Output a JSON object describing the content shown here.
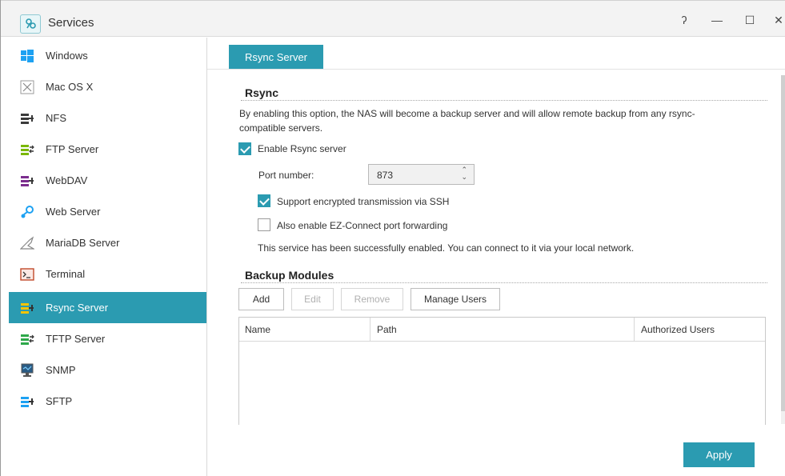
{
  "window": {
    "title": "Services",
    "help_glyph": "ʔ",
    "minimize_glyph": "—",
    "maximize_glyph": "☐",
    "close_glyph": "✕"
  },
  "sidebar": {
    "items": [
      {
        "label": "Windows",
        "icon": "windows-icon"
      },
      {
        "label": "Mac OS X",
        "icon": "mac-x-icon"
      },
      {
        "label": "NFS",
        "icon": "nfs-icon"
      },
      {
        "label": "FTP Server",
        "icon": "ftp-icon"
      },
      {
        "label": "WebDAV",
        "icon": "webdav-icon"
      },
      {
        "label": "Web Server",
        "icon": "web-server-icon"
      },
      {
        "label": "MariaDB Server",
        "icon": "mariadb-icon"
      },
      {
        "label": "Terminal",
        "icon": "terminal-icon"
      },
      {
        "label": "Rsync Server",
        "icon": "rsync-icon",
        "active": true
      },
      {
        "label": "TFTP Server",
        "icon": "tftp-icon"
      },
      {
        "label": "SNMP",
        "icon": "snmp-icon"
      },
      {
        "label": "SFTP",
        "icon": "sftp-icon"
      }
    ]
  },
  "main": {
    "tab_label": "Rsync Server",
    "rsync": {
      "section_title": "Rsync",
      "description_line1": "By enabling this option, the NAS will become a backup server and will allow remote backup from any rsync-",
      "description_line2": "compatible servers.",
      "enable_label": "Enable Rsync server",
      "enable_checked": true,
      "port_label": "Port number:",
      "port_value": "873",
      "ssh_label": "Support encrypted transmission via SSH",
      "ssh_checked": true,
      "ezconnect_label": "Also enable EZ-Connect port forwarding",
      "ezconnect_checked": false,
      "status_text": "This service has been successfully enabled. You can connect to it via your local network."
    },
    "backup": {
      "section_title": "Backup Modules",
      "buttons": {
        "add": "Add",
        "edit": "Edit",
        "remove": "Remove",
        "manage_users": "Manage Users"
      },
      "columns": [
        "Name",
        "Path",
        "Authorized Users"
      ],
      "rows": []
    },
    "apply_label": "Apply"
  },
  "colors": {
    "accent": "#2b9bb1"
  }
}
